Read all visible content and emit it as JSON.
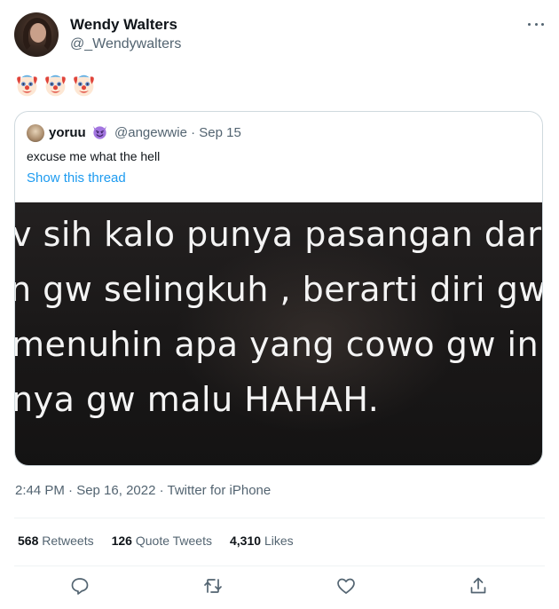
{
  "user": {
    "display_name": "Wendy Walters",
    "handle": "@_Wendywalters"
  },
  "tweet": {
    "emojis": [
      "clown-face",
      "clown-face",
      "clown-face"
    ],
    "timestamp": "2:44 PM · Sep 16, 2022 · Twitter for iPhone"
  },
  "quoted": {
    "name": "yoruu",
    "name_emoji": "smiling-devil",
    "meta": "@angewwie · Sep 15",
    "text": "excuse me what the hell",
    "show_thread": "Show this thread",
    "media_lines": [
      "v sih kalo punya pasangan dar",
      "n gw selingkuh , berarti diri gw",
      "menuhin apa yang cowo gw in",
      "nya gw malu HAHAH."
    ]
  },
  "stats": [
    {
      "count": "568",
      "label": "Retweets"
    },
    {
      "count": "126",
      "label": "Quote Tweets"
    },
    {
      "count": "4,310",
      "label": "Likes"
    }
  ],
  "actions": [
    "reply-icon",
    "retweet-icon",
    "like-icon",
    "share-icon"
  ],
  "colors": {
    "link": "#1d9bf0",
    "secondary_text": "#536471",
    "border": "#cfd9de"
  }
}
